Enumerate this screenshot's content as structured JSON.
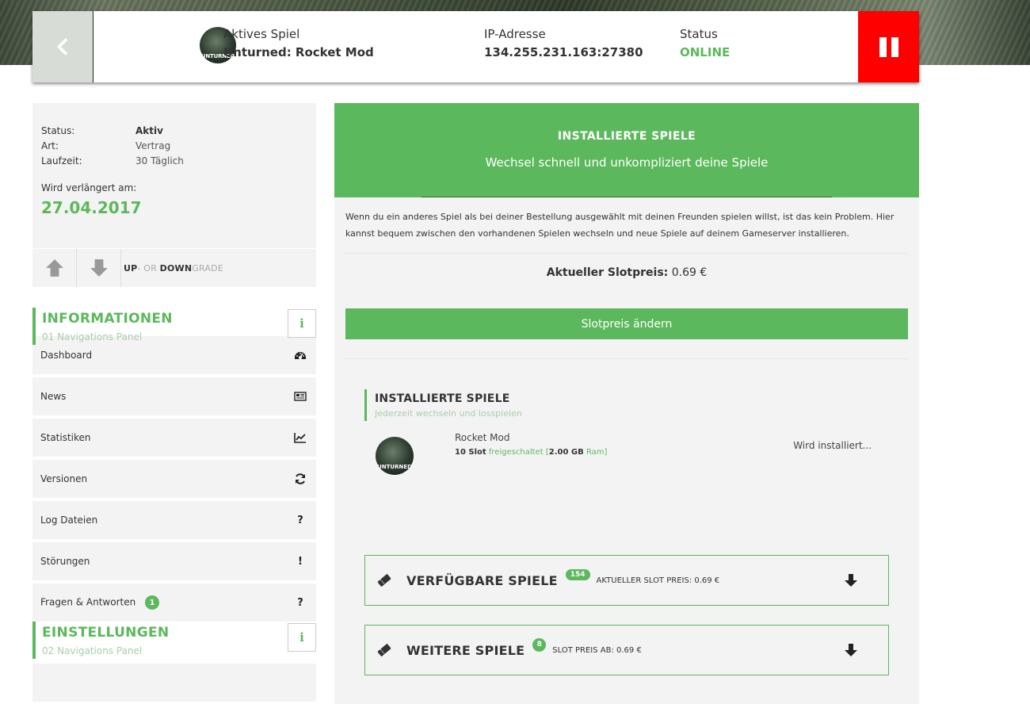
{
  "topbar": {
    "game_logo_text": "UNTURNED",
    "active_game_label": "Aktives Spiel",
    "active_game_value": "Unturned: Rocket Mod",
    "ip_label": "IP-Adresse",
    "ip_value": "134.255.231.163:27380",
    "status_label": "Status",
    "status_value": "ONLINE",
    "status_color": "#5cb85c",
    "pause_color": "#ff0000"
  },
  "contract": {
    "rows": [
      {
        "key": "Status:",
        "value": "Aktiv"
      },
      {
        "key": "Art:",
        "value": "Vertrag"
      },
      {
        "key": "Laufzeit:",
        "value": "30 Täglich"
      }
    ],
    "renew_label": "Wird verlängert am:",
    "renew_date": "27.04.2017",
    "updown_up": "UP",
    "updown_or": "- OR ",
    "updown_down": "DOWN",
    "updown_grade": "GRADE"
  },
  "panel_info": {
    "title": "INFORMATIONEN",
    "subtitle": "01 Navigations Panel",
    "info_glyph": "i"
  },
  "nav": [
    {
      "label": "Dashboard",
      "icon": "dashboard-icon"
    },
    {
      "label": "News",
      "icon": "newspaper-icon"
    },
    {
      "label": "Statistiken",
      "icon": "line-chart-icon"
    },
    {
      "label": "Versionen",
      "icon": "refresh-icon"
    },
    {
      "label": "Log Dateien",
      "icon": "question-icon",
      "glyph": "?"
    },
    {
      "label": "Störungen",
      "icon": "exclamation-icon",
      "glyph": "!"
    },
    {
      "label": "Fragen & Antworten",
      "icon": "question-icon",
      "glyph": "?",
      "badge": "1"
    }
  ],
  "panel_settings": {
    "title": "EINSTELLUNGEN",
    "subtitle": "02 Navigations Panel",
    "info_glyph": "i"
  },
  "main": {
    "hero_title": "INSTALLIERTE SPIELE",
    "hero_subtitle": "Wechsel schnell und unkompliziert deine Spiele",
    "description": "Wenn du ein anderes Spiel als bei deiner Bestellung ausgewählt mit deinen Freunden spielen willst, ist das kein Problem. Hier kannst bequem zwischen den vorhandenen Spielen wechseln und neue Spiele auf deinem Gameserver installieren.",
    "slotprice_label": "Aktueller Slotpreis:",
    "slotprice_value": "0.69 €",
    "slotprice_button": "Slotpreis ändern",
    "installed_title": "INSTALLIERTE SPIELE",
    "installed_subtitle": "Jederzeit wechseln und losspielen",
    "installed_game": {
      "logo_text": "UNTURNED",
      "name": "Rocket Mod",
      "slots": "10 Slot",
      "unlocked": "freigeschaltet",
      "ram_open": "[",
      "ram": "2.00 GB",
      "ram_label": "Ram",
      "ram_close": "]",
      "status": "Wird installiert..."
    },
    "available": {
      "title": "VERFÜGBARE SPIELE",
      "count": "154",
      "price": "AKTUELLER SLOT PREIS: 0.69 €"
    },
    "more": {
      "title": "WEITERE SPIELE",
      "count": "8",
      "price": "SLOT PREIS AB: 0.69 €"
    }
  }
}
